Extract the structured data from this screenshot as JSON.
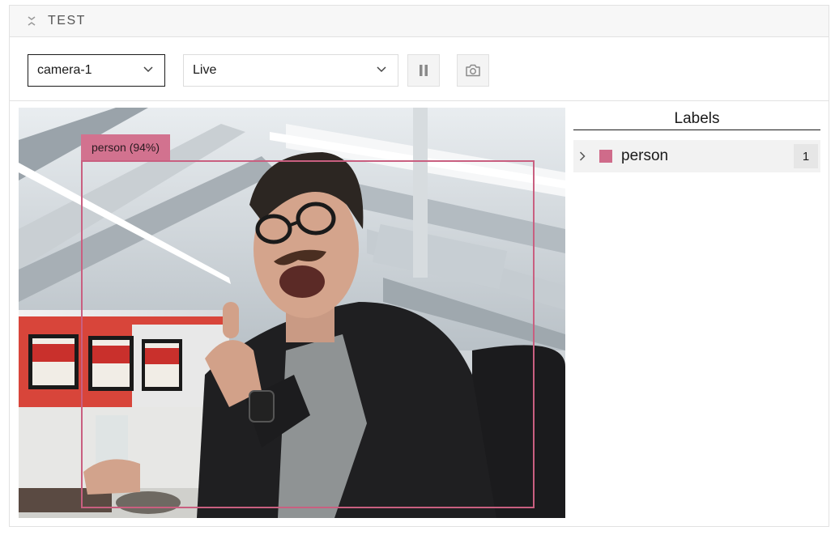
{
  "panel": {
    "title": "TEST"
  },
  "toolbar": {
    "camera_select": {
      "value": "camera-1"
    },
    "mode_select": {
      "value": "Live"
    },
    "pause_icon": "pause-icon",
    "snapshot_icon": "camera-icon"
  },
  "viewer": {
    "detection": {
      "label": "person (94%)",
      "color": "#c95f80"
    }
  },
  "labels": {
    "title": "Labels",
    "items": [
      {
        "name": "person",
        "count": "1",
        "color": "#cf6b8a"
      }
    ]
  }
}
